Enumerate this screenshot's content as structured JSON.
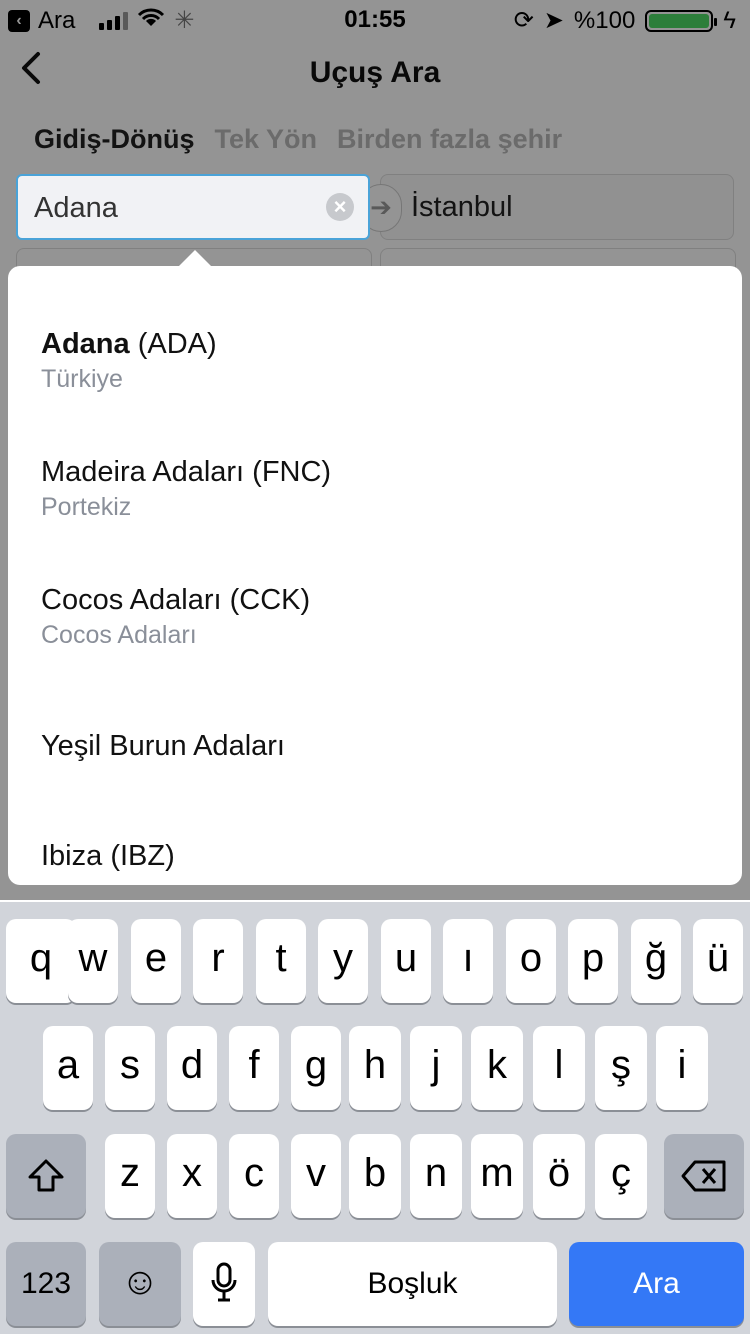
{
  "status": {
    "carrier": "Ara",
    "time": "01:55",
    "battery": "%100"
  },
  "header": {
    "title": "Uçuş Ara"
  },
  "tabs": [
    "Gidiş-Dönüş",
    "Tek Yön",
    "Birden fazla şehir"
  ],
  "search": {
    "value": "Adana",
    "to_value": "İstanbul"
  },
  "suggestions": [
    {
      "bold": "Adana",
      "rest": " (ADA)",
      "country": "Türkiye"
    },
    {
      "bold": "",
      "rest": "Madeira Adaları (FNC)",
      "country": "Portekiz"
    },
    {
      "bold": "",
      "rest": "Cocos Adaları (CCK)",
      "country": "Cocos Adaları"
    },
    {
      "bold": "",
      "rest": "Yeşil Burun Adaları",
      "country": ""
    },
    {
      "bold": "",
      "rest": "Ibiza (IBZ)",
      "country": ""
    }
  ],
  "keyboard": {
    "row1": [
      "q",
      "w",
      "e",
      "r",
      "t",
      "y",
      "u",
      "ı",
      "o",
      "p",
      "ğ",
      "ü"
    ],
    "row2": [
      "a",
      "s",
      "d",
      "f",
      "g",
      "h",
      "j",
      "k",
      "l",
      "ş",
      "i"
    ],
    "row3": [
      "z",
      "x",
      "c",
      "v",
      "b",
      "n",
      "m",
      "ö",
      "ç"
    ],
    "numbers_label": "123",
    "space_label": "Boşluk",
    "action_label": "Ara"
  }
}
